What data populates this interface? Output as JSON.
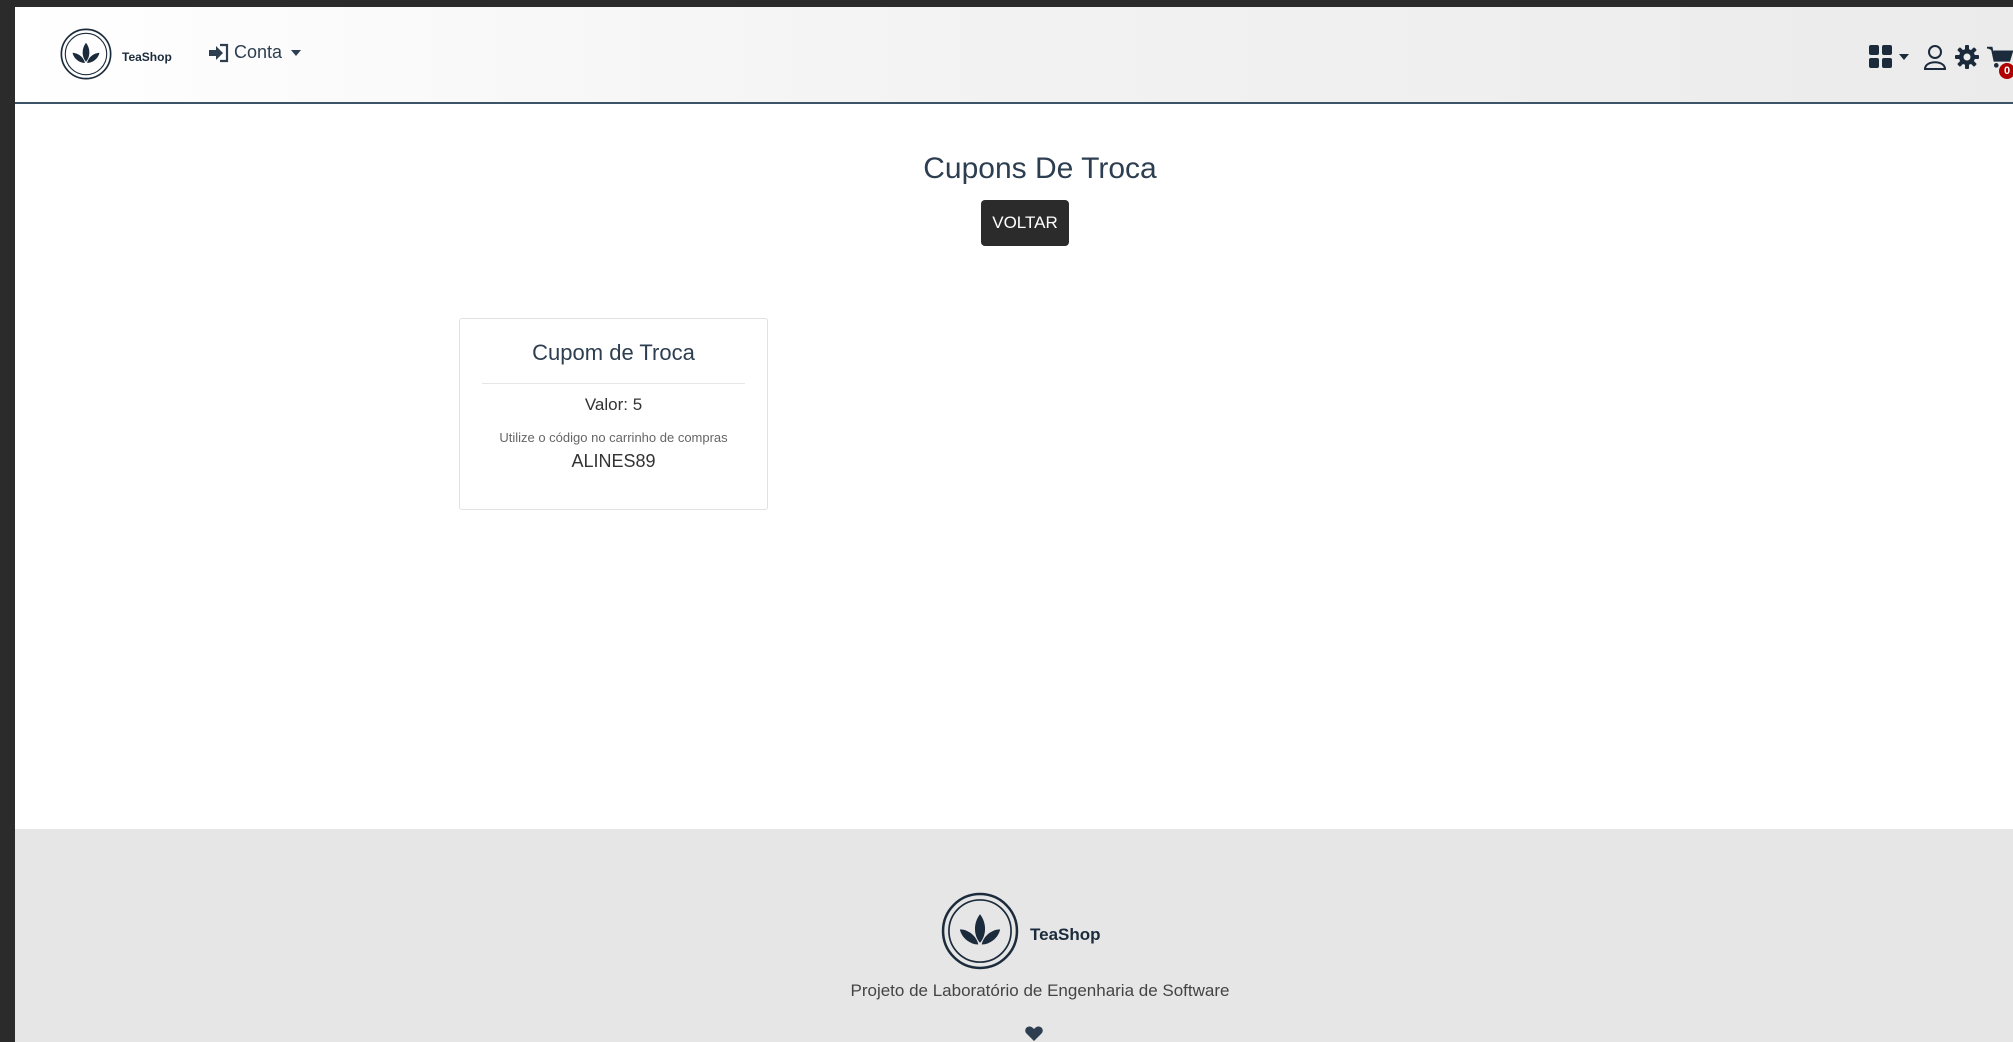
{
  "navbar": {
    "brand_name": "TeaShop",
    "account_label": "Conta",
    "cart_count": "0"
  },
  "main": {
    "title": "Cupons De Troca",
    "back_button": "VOLTAR",
    "coupons": [
      {
        "title": "Cupom de Troca",
        "value_text": "Valor: 5",
        "hint": "Utilize o código no carrinho de compras",
        "code": "ALINES89"
      }
    ]
  },
  "footer": {
    "brand_name": "TeaShop",
    "text": "Projeto de Laboratório de Engenharia de Software"
  },
  "icons": {
    "logo": "lotus-logo-icon",
    "login": "sign-in-icon",
    "grid": "grid-icon",
    "user": "user-icon",
    "settings": "gear-icon",
    "cart": "shopping-cart-icon",
    "heart": "heart-icon"
  },
  "colors": {
    "navbar_border": "#3c5466",
    "button_bg": "#2b2b2b",
    "badge": "#b00000",
    "footer_bg": "#e6e6e6",
    "text": "#2c3e50"
  }
}
